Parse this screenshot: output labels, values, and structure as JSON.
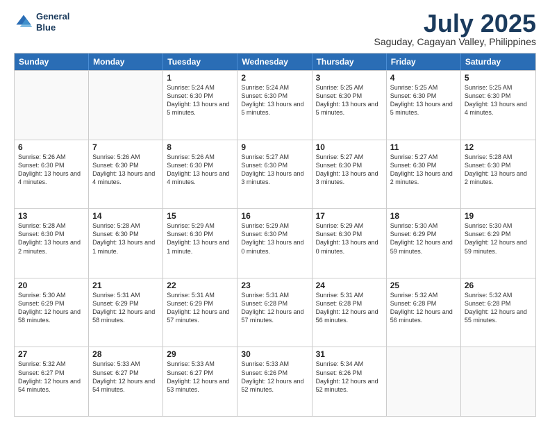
{
  "logo": {
    "line1": "General",
    "line2": "Blue"
  },
  "title": "July 2025",
  "subtitle": "Saguday, Cagayan Valley, Philippines",
  "days_of_week": [
    "Sunday",
    "Monday",
    "Tuesday",
    "Wednesday",
    "Thursday",
    "Friday",
    "Saturday"
  ],
  "weeks": [
    [
      {
        "day": "",
        "info": ""
      },
      {
        "day": "",
        "info": ""
      },
      {
        "day": "1",
        "info": "Sunrise: 5:24 AM\nSunset: 6:30 PM\nDaylight: 13 hours and 5 minutes."
      },
      {
        "day": "2",
        "info": "Sunrise: 5:24 AM\nSunset: 6:30 PM\nDaylight: 13 hours and 5 minutes."
      },
      {
        "day": "3",
        "info": "Sunrise: 5:25 AM\nSunset: 6:30 PM\nDaylight: 13 hours and 5 minutes."
      },
      {
        "day": "4",
        "info": "Sunrise: 5:25 AM\nSunset: 6:30 PM\nDaylight: 13 hours and 5 minutes."
      },
      {
        "day": "5",
        "info": "Sunrise: 5:25 AM\nSunset: 6:30 PM\nDaylight: 13 hours and 4 minutes."
      }
    ],
    [
      {
        "day": "6",
        "info": "Sunrise: 5:26 AM\nSunset: 6:30 PM\nDaylight: 13 hours and 4 minutes."
      },
      {
        "day": "7",
        "info": "Sunrise: 5:26 AM\nSunset: 6:30 PM\nDaylight: 13 hours and 4 minutes."
      },
      {
        "day": "8",
        "info": "Sunrise: 5:26 AM\nSunset: 6:30 PM\nDaylight: 13 hours and 4 minutes."
      },
      {
        "day": "9",
        "info": "Sunrise: 5:27 AM\nSunset: 6:30 PM\nDaylight: 13 hours and 3 minutes."
      },
      {
        "day": "10",
        "info": "Sunrise: 5:27 AM\nSunset: 6:30 PM\nDaylight: 13 hours and 3 minutes."
      },
      {
        "day": "11",
        "info": "Sunrise: 5:27 AM\nSunset: 6:30 PM\nDaylight: 13 hours and 2 minutes."
      },
      {
        "day": "12",
        "info": "Sunrise: 5:28 AM\nSunset: 6:30 PM\nDaylight: 13 hours and 2 minutes."
      }
    ],
    [
      {
        "day": "13",
        "info": "Sunrise: 5:28 AM\nSunset: 6:30 PM\nDaylight: 13 hours and 2 minutes."
      },
      {
        "day": "14",
        "info": "Sunrise: 5:28 AM\nSunset: 6:30 PM\nDaylight: 13 hours and 1 minute."
      },
      {
        "day": "15",
        "info": "Sunrise: 5:29 AM\nSunset: 6:30 PM\nDaylight: 13 hours and 1 minute."
      },
      {
        "day": "16",
        "info": "Sunrise: 5:29 AM\nSunset: 6:30 PM\nDaylight: 13 hours and 0 minutes."
      },
      {
        "day": "17",
        "info": "Sunrise: 5:29 AM\nSunset: 6:30 PM\nDaylight: 13 hours and 0 minutes."
      },
      {
        "day": "18",
        "info": "Sunrise: 5:30 AM\nSunset: 6:29 PM\nDaylight: 12 hours and 59 minutes."
      },
      {
        "day": "19",
        "info": "Sunrise: 5:30 AM\nSunset: 6:29 PM\nDaylight: 12 hours and 59 minutes."
      }
    ],
    [
      {
        "day": "20",
        "info": "Sunrise: 5:30 AM\nSunset: 6:29 PM\nDaylight: 12 hours and 58 minutes."
      },
      {
        "day": "21",
        "info": "Sunrise: 5:31 AM\nSunset: 6:29 PM\nDaylight: 12 hours and 58 minutes."
      },
      {
        "day": "22",
        "info": "Sunrise: 5:31 AM\nSunset: 6:29 PM\nDaylight: 12 hours and 57 minutes."
      },
      {
        "day": "23",
        "info": "Sunrise: 5:31 AM\nSunset: 6:28 PM\nDaylight: 12 hours and 57 minutes."
      },
      {
        "day": "24",
        "info": "Sunrise: 5:31 AM\nSunset: 6:28 PM\nDaylight: 12 hours and 56 minutes."
      },
      {
        "day": "25",
        "info": "Sunrise: 5:32 AM\nSunset: 6:28 PM\nDaylight: 12 hours and 56 minutes."
      },
      {
        "day": "26",
        "info": "Sunrise: 5:32 AM\nSunset: 6:28 PM\nDaylight: 12 hours and 55 minutes."
      }
    ],
    [
      {
        "day": "27",
        "info": "Sunrise: 5:32 AM\nSunset: 6:27 PM\nDaylight: 12 hours and 54 minutes."
      },
      {
        "day": "28",
        "info": "Sunrise: 5:33 AM\nSunset: 6:27 PM\nDaylight: 12 hours and 54 minutes."
      },
      {
        "day": "29",
        "info": "Sunrise: 5:33 AM\nSunset: 6:27 PM\nDaylight: 12 hours and 53 minutes."
      },
      {
        "day": "30",
        "info": "Sunrise: 5:33 AM\nSunset: 6:26 PM\nDaylight: 12 hours and 52 minutes."
      },
      {
        "day": "31",
        "info": "Sunrise: 5:34 AM\nSunset: 6:26 PM\nDaylight: 12 hours and 52 minutes."
      },
      {
        "day": "",
        "info": ""
      },
      {
        "day": "",
        "info": ""
      }
    ]
  ]
}
